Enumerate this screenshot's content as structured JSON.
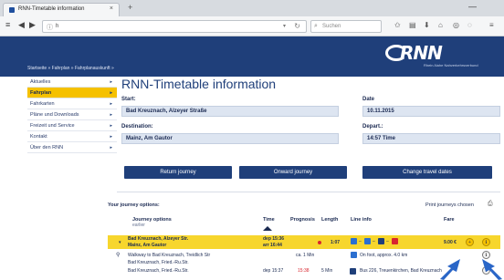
{
  "browser": {
    "tab_title": "RNN-Timetable information",
    "tab_close": "×",
    "new_tab": "+",
    "url": "h",
    "url_drop": "▾",
    "reload": "↻",
    "search_placeholder": "Suchen",
    "window_min": "—"
  },
  "site": {
    "logo_text": "RNN",
    "logo_tag": "Rhein-Nahe Nahverkehrsverbund",
    "breadcrumb": "Startseite » Fahrplan » Fahrplanauskunft »"
  },
  "sidebar": {
    "items": [
      {
        "label": "Aktuelles",
        "arrow": "▸"
      },
      {
        "label": "Fahrplan",
        "arrow": "▸",
        "active": true
      },
      {
        "label": "Fahrkarten",
        "arrow": "▸"
      },
      {
        "label": "Pläne und Downloads",
        "arrow": "▸"
      },
      {
        "label": "Freizeit und Service",
        "arrow": "▸"
      },
      {
        "label": "Kontakt",
        "arrow": "▸"
      },
      {
        "label": "Über den RNN",
        "arrow": "▸"
      }
    ]
  },
  "main": {
    "title": "RNN-Timetable information",
    "start_label": "Start:",
    "start_value": "Bad Kreuznach, Alzeyer Straße",
    "destination_label": "Destination:",
    "destination_value": "Mainz, Am Gautor",
    "date_label": "Date",
    "date_value": "10.11.2015",
    "depart_label": "Depart.:",
    "depart_value": "14:57 Time",
    "return_btn": "Return journey",
    "onward_btn": "Onward journey",
    "change_btn": "Change travel dates"
  },
  "results": {
    "heading": "Your journey options:",
    "print_label": "Print journeys chosen",
    "columns": {
      "options": "Journey options",
      "options_sub": "earlier",
      "time": "Time",
      "prognosis": "Prognosis",
      "length": "Length",
      "line_info": "Line info",
      "fare": "Fare"
    },
    "rows": [
      {
        "caret": "▾",
        "stop1": "Bad Kreuznach, Alzeyer Str.",
        "stop2": "Mainz, Am Gautor",
        "dep": "dep 15:36",
        "arr": "arr 16:44",
        "length": "1:07",
        "fare": "9.00 €",
        "plus": "+",
        "info": "ℹ"
      },
      {
        "text": "Walkway to Bad Kreuznach, Treidlich Str",
        "dur": "ca. 1 Min",
        "note": "On foot, approx. 4.0 km",
        "info": "ℹ"
      },
      {
        "text": "Bad Kreuznach, Fried.-Ru.Str."
      },
      {
        "text": "Bad Kreuznach, Fried.-Ru.Str.",
        "dep": "dep 15:37",
        "prog": "15:38",
        "dur": "5 Min",
        "line": "Bus 226, Treuenkirchen, Bad Kreuznach",
        "info": "ℹ"
      }
    ]
  },
  "colors": {
    "brand_blue": "#1f3f7a",
    "accent_yellow": "#f5c100",
    "highlight_row": "#f7d62d",
    "delay_red": "#d8262f"
  }
}
